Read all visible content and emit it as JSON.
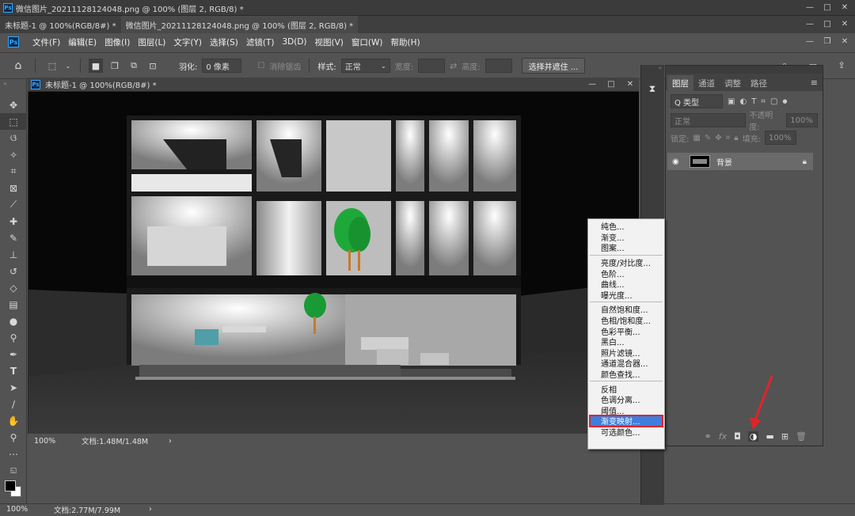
{
  "app": {
    "tabs": [
      {
        "label": "微信图片_20211128124048.png @ 100% (图层 2, RGB/8) *",
        "active": false
      },
      {
        "label": "未标题-1 @ 100%(RGB/8#) *",
        "active": false
      },
      {
        "label": "微信图片_20211128124048.png @ 100% (图层 2, RGB/8) *",
        "active": true
      }
    ],
    "logo": "Ps"
  },
  "menubar": {
    "items": [
      "文件(F)",
      "编辑(E)",
      "图像(I)",
      "图层(L)",
      "文字(Y)",
      "选择(S)",
      "滤镜(T)",
      "3D(D)",
      "视图(V)",
      "窗口(W)",
      "帮助(H)"
    ]
  },
  "options": {
    "feather_label": "羽化:",
    "feather_value": "0 像素",
    "antialias_label": "消除锯齿",
    "style_label": "样式:",
    "style_value": "正常",
    "width_label": "宽度:",
    "height_label": "高度:",
    "select_mask_button": "选择并遮住 ..."
  },
  "document": {
    "title": "未标题-1 @ 100%(RGB/8#) *",
    "zoom": "100%",
    "doc_size": "文档:1.48M/1.48M",
    "arrow": "›"
  },
  "bottom_status": {
    "zoom": "100%",
    "doc_size": "文档:2.77M/7.99M",
    "arrow": "›"
  },
  "layers_panel": {
    "tabs": [
      "图层",
      "通道",
      "调整",
      "路径"
    ],
    "filter_label": "Q 类型",
    "blend_mode": "正常",
    "opacity_label": "不透明度:",
    "opacity_value": "100%",
    "lock_label": "锁定:",
    "fill_label": "填充:",
    "fill_value": "100%",
    "layer_name": "背景"
  },
  "context_menu": {
    "groups": [
      [
        "纯色...",
        "渐变...",
        "图案..."
      ],
      [
        "亮度/对比度...",
        "色阶...",
        "曲线...",
        "曝光度..."
      ],
      [
        "自然饱和度...",
        "色相/饱和度...",
        "色彩平衡...",
        "黑白...",
        "照片滤镜...",
        "通道混合器...",
        "颜色查找..."
      ],
      [
        "反相",
        "色调分离...",
        "阈值...",
        "渐变映射...",
        "可选颜色..."
      ]
    ],
    "highlighted": "渐变映射..."
  },
  "colors": {
    "highlight": "#3c7fde",
    "annotation_red": "#e0242b",
    "ps_blue": "#31a8ff"
  }
}
